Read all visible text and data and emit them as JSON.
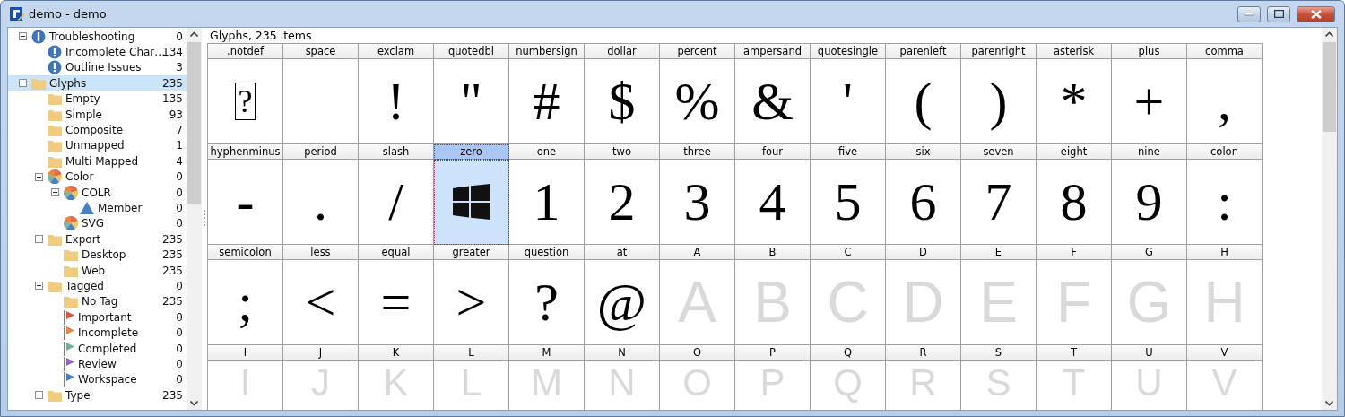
{
  "window": {
    "title": "demo - demo"
  },
  "tree": [
    {
      "label": "Troubleshooting",
      "count": "0",
      "kind": "warning",
      "expanded": true,
      "selected": false,
      "children": [
        {
          "label": "Incomplete Char…",
          "count": "134",
          "kind": "warning",
          "selected": false
        },
        {
          "label": "Outline Issues",
          "count": "3",
          "kind": "warning",
          "selected": false
        }
      ]
    },
    {
      "label": "Glyphs",
      "count": "235",
      "kind": "folder",
      "expanded": true,
      "selected": true,
      "children": [
        {
          "label": "Empty",
          "count": "135",
          "kind": "folder",
          "selected": false
        },
        {
          "label": "Simple",
          "count": "93",
          "kind": "folder",
          "selected": false
        },
        {
          "label": "Composite",
          "count": "7",
          "kind": "folder",
          "selected": false
        },
        {
          "label": "Unmapped",
          "count": "1",
          "kind": "folder",
          "selected": false
        },
        {
          "label": "Multi Mapped",
          "count": "4",
          "kind": "folder",
          "selected": false
        },
        {
          "label": "Color",
          "count": "0",
          "kind": "palette",
          "expanded": true,
          "selected": false,
          "children": [
            {
              "label": "COLR",
              "count": "0",
              "kind": "palette",
              "expanded": true,
              "selected": false,
              "children": [
                {
                  "label": "Member",
                  "count": "0",
                  "kind": "triangle",
                  "selected": false
                }
              ]
            },
            {
              "label": "SVG",
              "count": "0",
              "kind": "palette",
              "selected": false
            }
          ]
        },
        {
          "label": "Export",
          "count": "235",
          "kind": "folder",
          "expanded": true,
          "selected": false,
          "children": [
            {
              "label": "Desktop",
              "count": "235",
              "kind": "folder",
              "selected": false
            },
            {
              "label": "Web",
              "count": "235",
              "kind": "folder",
              "selected": false
            }
          ]
        },
        {
          "label": "Tagged",
          "count": "0",
          "kind": "folder",
          "expanded": true,
          "selected": false,
          "children": [
            {
              "label": "No Tag",
              "count": "235",
              "kind": "folder",
              "selected": false
            },
            {
              "label": "Important",
              "count": "0",
              "kind": "flag",
              "color": "#d9573b",
              "selected": false
            },
            {
              "label": "Incomplete",
              "count": "0",
              "kind": "flag",
              "color": "#e8873a",
              "selected": false
            },
            {
              "label": "Completed",
              "count": "0",
              "kind": "flag",
              "color": "#6fae97",
              "selected": false
            },
            {
              "label": "Review",
              "count": "0",
              "kind": "flag",
              "color": "#9a5fc0",
              "selected": false
            },
            {
              "label": "Workspace",
              "count": "0",
              "kind": "flag",
              "color": "#4a7fc1",
              "selected": false
            }
          ]
        },
        {
          "label": "Type",
          "count": "235",
          "kind": "folder",
          "expanded": true,
          "selected": false
        }
      ]
    }
  ],
  "grid": {
    "caption": "Glyphs, 235 items",
    "glyphs": [
      {
        "name": ".notdef",
        "kind": "notdef",
        "char": "?",
        "selected": false
      },
      {
        "name": "space",
        "kind": "outline",
        "selected": false
      },
      {
        "name": "exclam",
        "kind": "outline",
        "char": "!",
        "selected": false
      },
      {
        "name": "quotedbl",
        "kind": "outline",
        "char": "\"",
        "selected": false
      },
      {
        "name": "numbersign",
        "kind": "outline",
        "char": "#",
        "selected": false
      },
      {
        "name": "dollar",
        "kind": "outline",
        "char": "$",
        "selected": false
      },
      {
        "name": "percent",
        "kind": "outline",
        "char": "%",
        "selected": false
      },
      {
        "name": "ampersand",
        "kind": "outline",
        "char": "&",
        "selected": false
      },
      {
        "name": "quotesingle",
        "kind": "outline",
        "char": "'",
        "selected": false
      },
      {
        "name": "parenleft",
        "kind": "outline",
        "char": "(",
        "selected": false
      },
      {
        "name": "parenright",
        "kind": "outline",
        "char": ")",
        "selected": false
      },
      {
        "name": "asterisk",
        "kind": "outline",
        "char": "*",
        "selected": false
      },
      {
        "name": "plus",
        "kind": "outline",
        "char": "+",
        "selected": false
      },
      {
        "name": "comma",
        "kind": "outline",
        "char": ",",
        "selected": false
      },
      {
        "name": "hyphenminus",
        "kind": "outline",
        "char": "-",
        "selected": false
      },
      {
        "name": "period",
        "kind": "outline",
        "char": ".",
        "selected": false
      },
      {
        "name": "slash",
        "kind": "outline",
        "char": "/",
        "selected": false
      },
      {
        "name": "zero",
        "kind": "logo",
        "selected": true
      },
      {
        "name": "one",
        "kind": "outline",
        "char": "1",
        "selected": false
      },
      {
        "name": "two",
        "kind": "outline",
        "char": "2",
        "selected": false
      },
      {
        "name": "three",
        "kind": "outline",
        "char": "3",
        "selected": false
      },
      {
        "name": "four",
        "kind": "outline",
        "char": "4",
        "selected": false
      },
      {
        "name": "five",
        "kind": "outline",
        "char": "5",
        "selected": false
      },
      {
        "name": "six",
        "kind": "outline",
        "char": "6",
        "selected": false
      },
      {
        "name": "seven",
        "kind": "outline",
        "char": "7",
        "selected": false
      },
      {
        "name": "eight",
        "kind": "outline",
        "char": "8",
        "selected": false
      },
      {
        "name": "nine",
        "kind": "outline",
        "char": "9",
        "selected": false
      },
      {
        "name": "colon",
        "kind": "outline",
        "char": ":",
        "selected": false
      },
      {
        "name": "semicolon",
        "kind": "outline",
        "char": ";",
        "selected": false
      },
      {
        "name": "less",
        "kind": "outline",
        "char": "<",
        "selected": false
      },
      {
        "name": "equal",
        "kind": "outline",
        "char": "=",
        "selected": false
      },
      {
        "name": "greater",
        "kind": "outline",
        "char": ">",
        "selected": false
      },
      {
        "name": "question",
        "kind": "outline",
        "char": "?",
        "selected": false
      },
      {
        "name": "at",
        "kind": "outline",
        "char": "@",
        "selected": false
      },
      {
        "name": "A",
        "kind": "placeholder",
        "char": "A",
        "selected": false
      },
      {
        "name": "B",
        "kind": "placeholder",
        "char": "B",
        "selected": false
      },
      {
        "name": "C",
        "kind": "placeholder",
        "char": "C",
        "selected": false
      },
      {
        "name": "D",
        "kind": "placeholder",
        "char": "D",
        "selected": false
      },
      {
        "name": "E",
        "kind": "placeholder",
        "char": "E",
        "selected": false
      },
      {
        "name": "F",
        "kind": "placeholder",
        "char": "F",
        "selected": false
      },
      {
        "name": "G",
        "kind": "placeholder",
        "char": "G",
        "selected": false
      },
      {
        "name": "H",
        "kind": "placeholder",
        "char": "H",
        "selected": false
      },
      {
        "name": "I",
        "kind": "placeholder",
        "char": "I",
        "selected": false
      },
      {
        "name": "J",
        "kind": "placeholder",
        "char": "J",
        "selected": false
      },
      {
        "name": "K",
        "kind": "placeholder",
        "char": "K",
        "selected": false
      },
      {
        "name": "L",
        "kind": "placeholder",
        "char": "L",
        "selected": false
      },
      {
        "name": "M",
        "kind": "placeholder",
        "char": "M",
        "selected": false
      },
      {
        "name": "N",
        "kind": "placeholder",
        "char": "N",
        "selected": false
      },
      {
        "name": "O",
        "kind": "placeholder",
        "char": "O",
        "selected": false
      },
      {
        "name": "P",
        "kind": "placeholder",
        "char": "P",
        "selected": false
      },
      {
        "name": "Q",
        "kind": "placeholder",
        "char": "Q",
        "selected": false
      },
      {
        "name": "R",
        "kind": "placeholder",
        "char": "R",
        "selected": false
      },
      {
        "name": "S",
        "kind": "placeholder",
        "char": "S",
        "selected": false
      },
      {
        "name": "T",
        "kind": "placeholder",
        "char": "T",
        "selected": false
      },
      {
        "name": "U",
        "kind": "placeholder",
        "char": "U",
        "selected": false
      },
      {
        "name": "V",
        "kind": "placeholder",
        "char": "V",
        "selected": false
      }
    ]
  }
}
